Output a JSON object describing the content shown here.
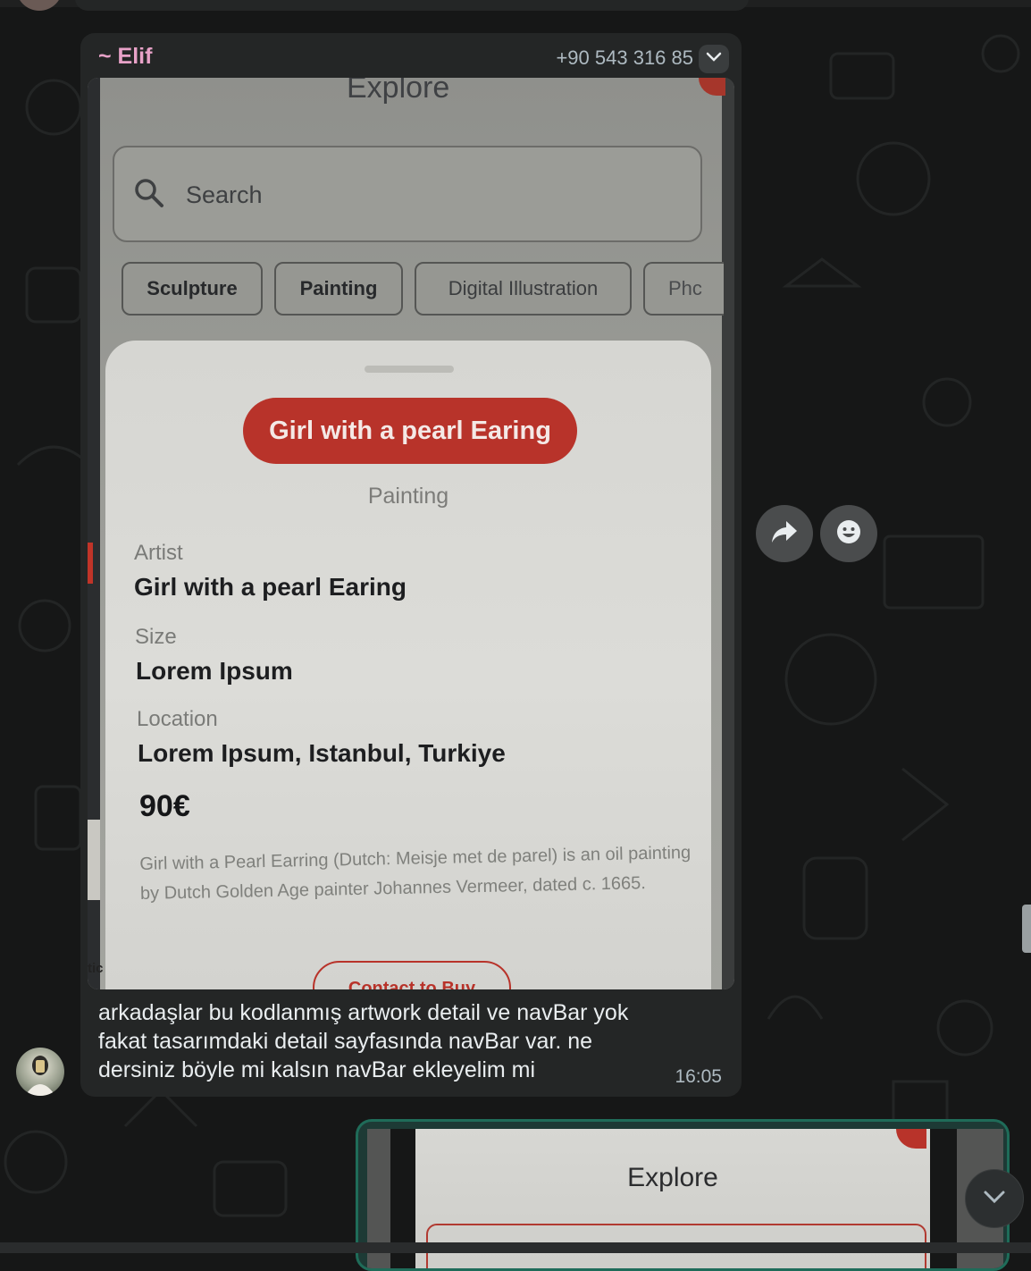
{
  "message": {
    "sender": "~ Elif",
    "phone": "+90 543 316 85",
    "text": "arkadaşlar bu kodlanmış artwork detail ve navBar yok fakat tasarımdaki detail sayfasında navBar var. ne dersiniz böyle mi kalsın navBar ekleyelim mi",
    "time": "16:05"
  },
  "photo_screen": {
    "header_title": "Explore",
    "search_placeholder": "Search",
    "chips": [
      "Sculpture",
      "Painting",
      "Digital Illustration",
      "Phc"
    ],
    "side_fragment": "tic",
    "artwork": {
      "title": "Girl with a pearl Earing",
      "category": "Painting",
      "artist_label": "Artist",
      "artist_value": "Girl with a pearl Earing",
      "size_label": "Size",
      "size_value": "Lorem Ipsum",
      "location_label": "Location",
      "location_value": "Lorem Ipsum, Istanbul, Turkiye",
      "price": "90€",
      "description": "Girl with a Pearl Earring (Dutch: Meisje met de parel) is an oil painting by Dutch Golden Age painter Johannes Vermeer, dated c. 1665.",
      "contact_button": "Contact to Buy"
    }
  },
  "next_message": {
    "header_title": "Explore"
  },
  "icons": {
    "menu": "chevron-down-icon",
    "forward": "forward-icon",
    "react": "emoji-icon",
    "scroll": "chevron-down-icon",
    "search": "search-icon"
  },
  "colors": {
    "sender_name": "#e8a2c8",
    "incoming_bubble": "#242626",
    "outgoing_border": "#1f6c59",
    "accent_red": "#b8332a"
  }
}
